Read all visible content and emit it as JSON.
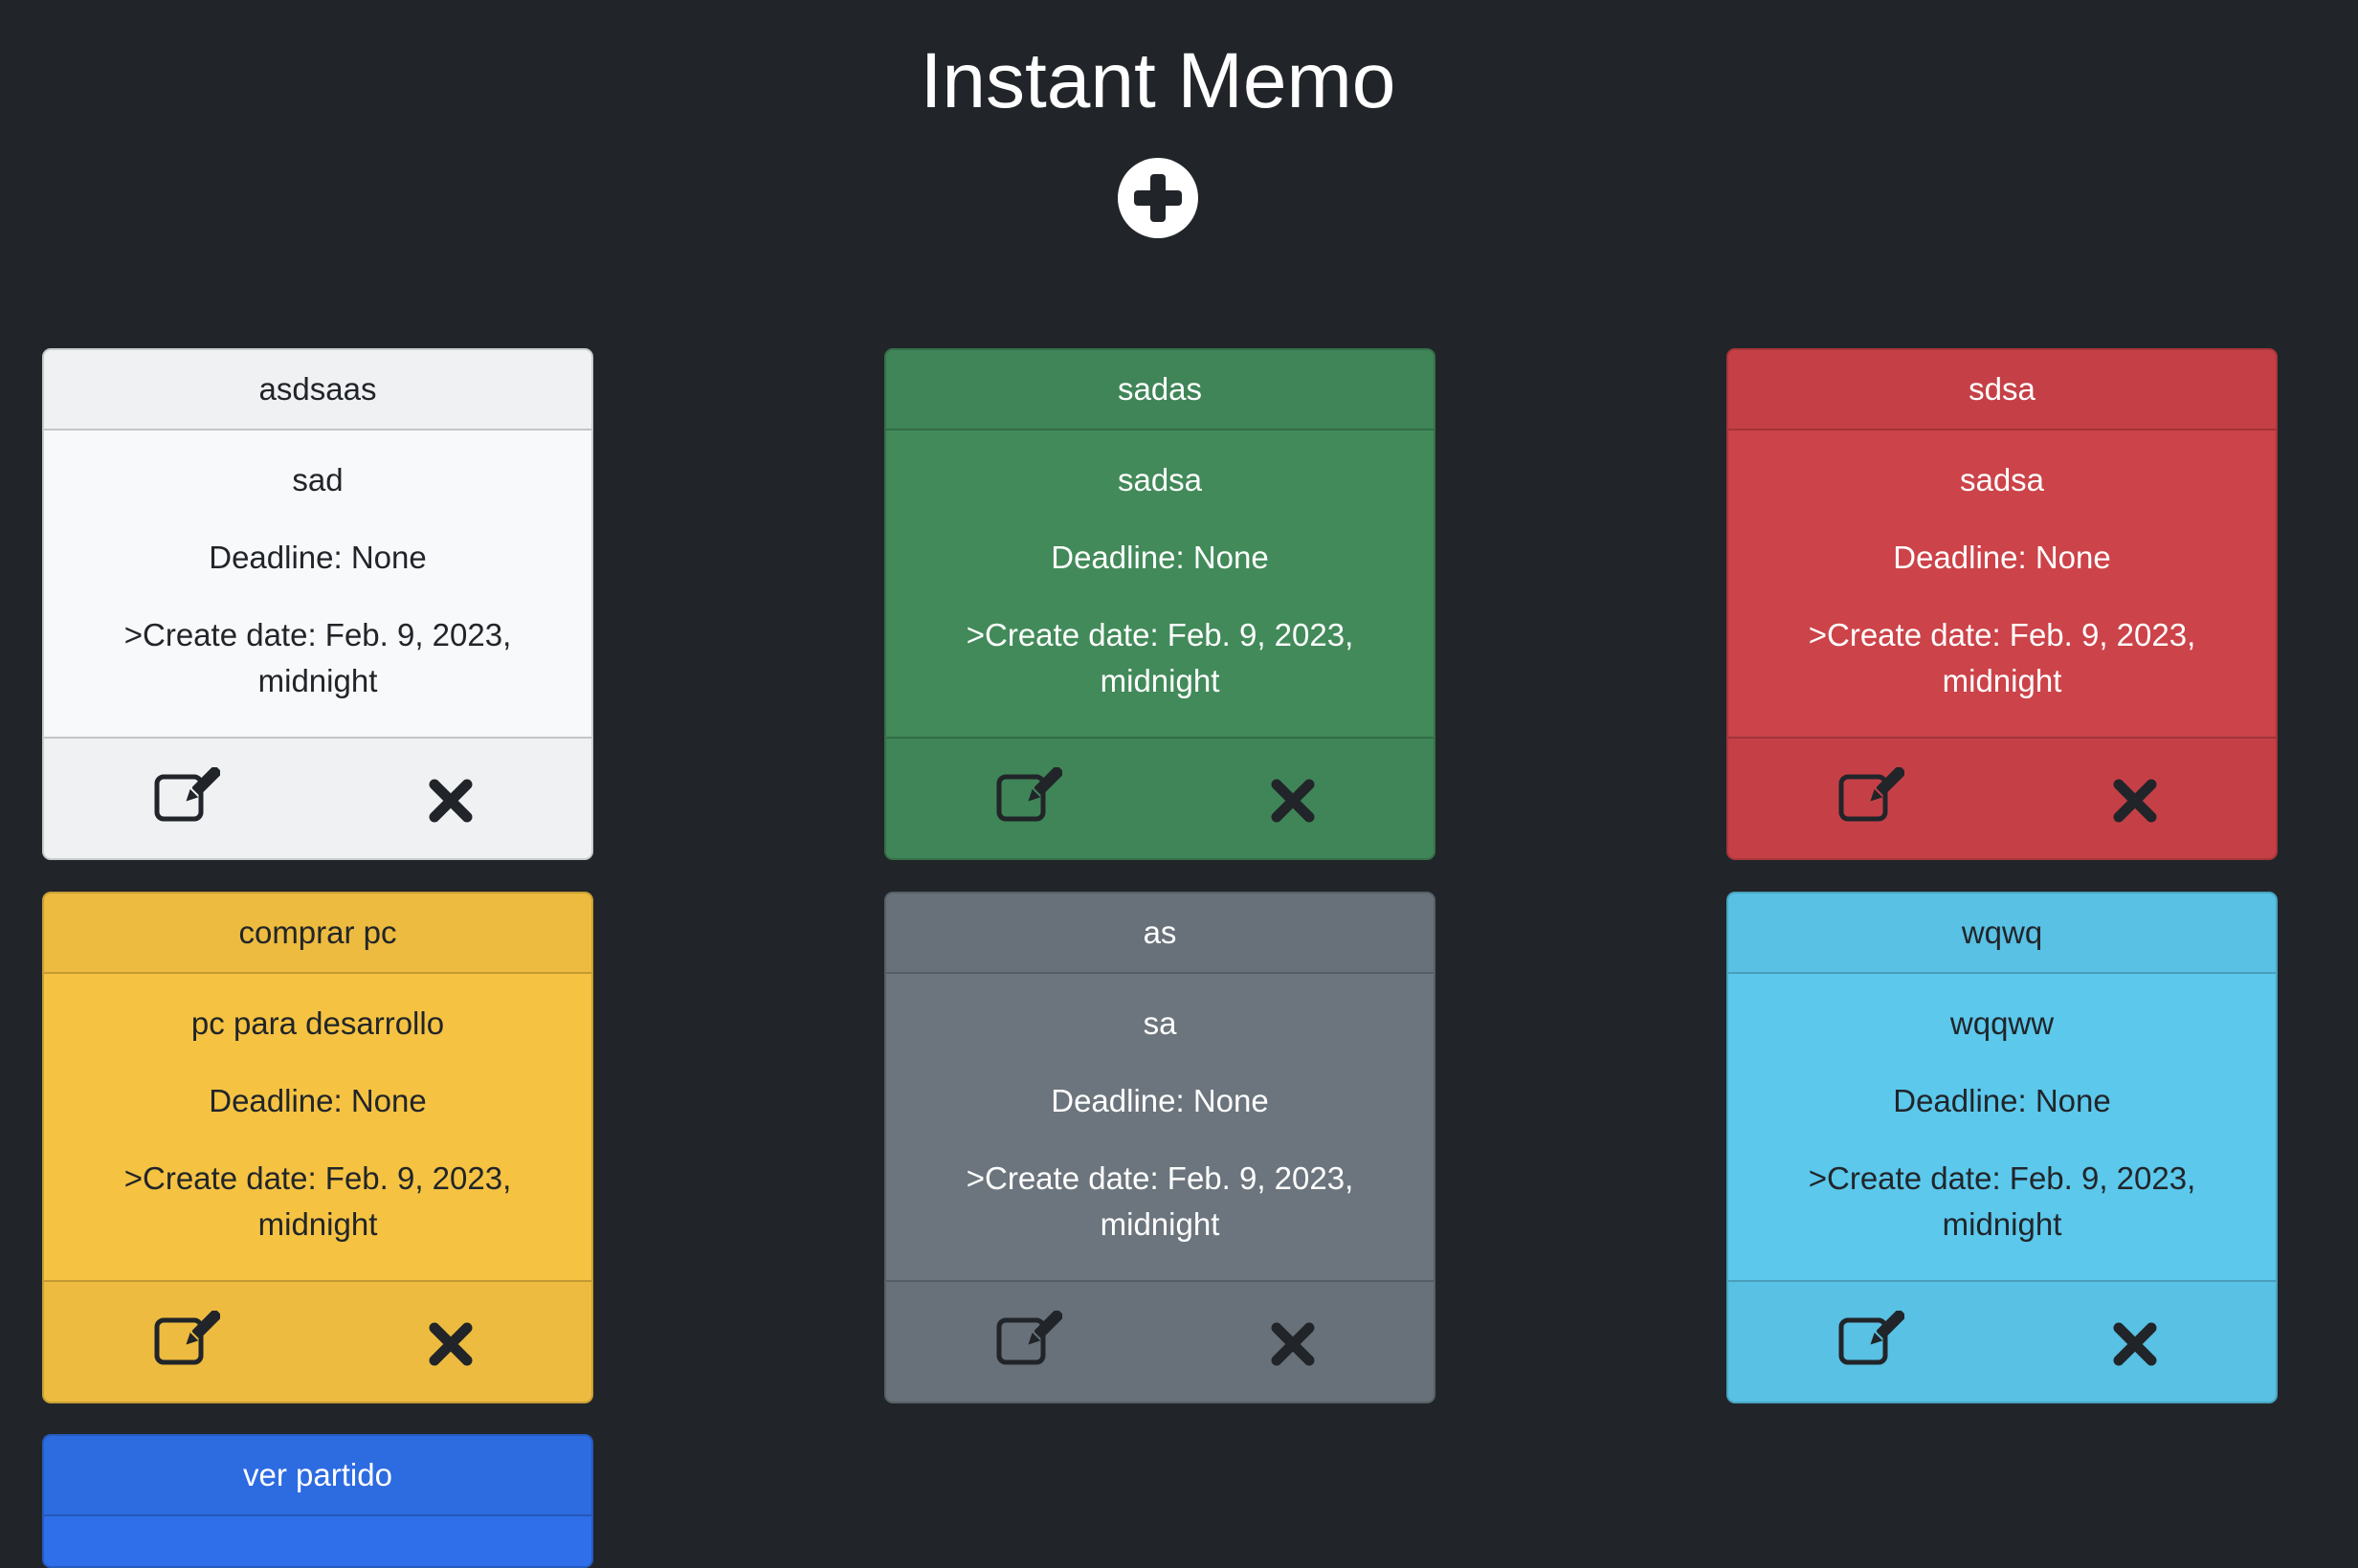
{
  "app": {
    "title": "Instant Memo",
    "add_icon": "plus-circle-icon"
  },
  "colors": {
    "background": "#212529",
    "light": "#f8f9fa",
    "green": "#428a5a",
    "red": "#cc4349",
    "yellow": "#f5c242",
    "gray": "#6c757d",
    "cyan": "#5bc8ec",
    "blue": "#2f6fe9"
  },
  "memos": [
    {
      "title": "asdsaas",
      "content": "sad",
      "deadline": "Deadline: None",
      "create_date": ">Create date: Feb. 9, 2023, midnight",
      "color": "light"
    },
    {
      "title": "sadas",
      "content": "sadsa",
      "deadline": "Deadline: None",
      "create_date": ">Create date: Feb. 9, 2023, midnight",
      "color": "green"
    },
    {
      "title": "sdsa",
      "content": "sadsa",
      "deadline": "Deadline: None",
      "create_date": ">Create date: Feb. 9, 2023, midnight",
      "color": "red"
    },
    {
      "title": "comprar pc",
      "content": "pc para desarrollo",
      "deadline": "Deadline: None",
      "create_date": ">Create date: Feb. 9, 2023, midnight",
      "color": "yellow"
    },
    {
      "title": "as",
      "content": "sa",
      "deadline": "Deadline: None",
      "create_date": ">Create date: Feb. 9, 2023, midnight",
      "color": "gray"
    },
    {
      "title": "wqwq",
      "content": "wqqww",
      "deadline": "Deadline: None",
      "create_date": ">Create date: Feb. 9, 2023, midnight",
      "color": "cyan"
    },
    {
      "title": "ver partido",
      "color": "blue"
    }
  ],
  "icons": {
    "edit": "edit-icon",
    "delete": "close-icon"
  }
}
